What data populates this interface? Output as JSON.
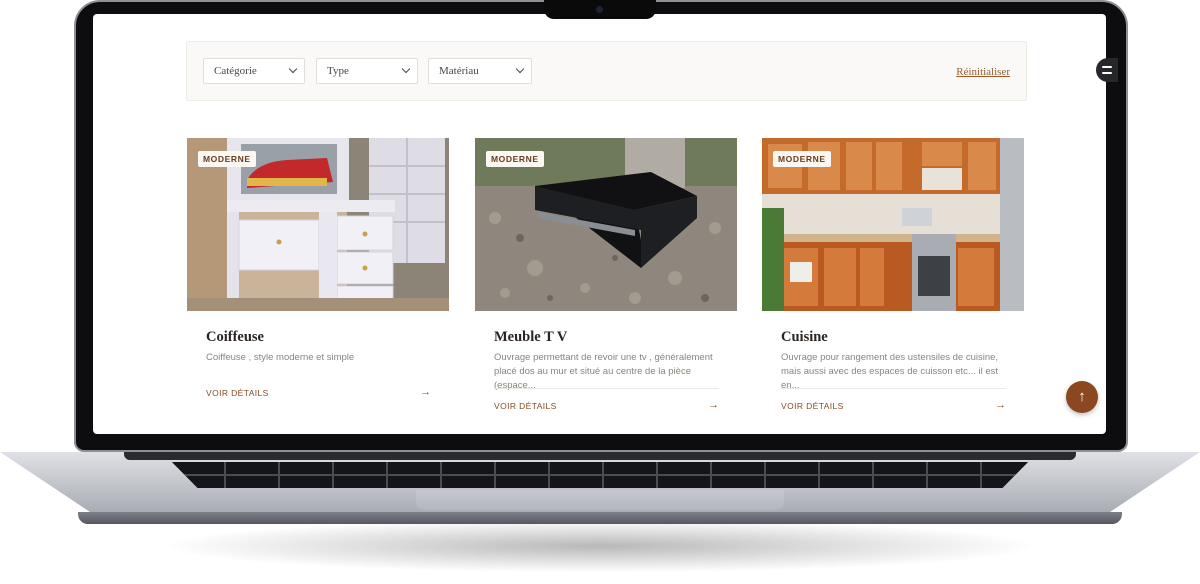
{
  "filters": {
    "category": {
      "label": "Catégorie"
    },
    "type": {
      "label": "Type"
    },
    "material": {
      "label": "Matériau"
    },
    "reset_label": "Réinitialiser"
  },
  "products": [
    {
      "badge": "MODERNE",
      "title": "Coiffeuse",
      "description": "Coiffeuse , style moderne et simple",
      "link": "VOIR DÉTAILS",
      "image": "dressing-table-photo"
    },
    {
      "badge": "MODERNE",
      "title": "Meuble T V",
      "description": "Ouvrage permettant de revoir une tv , généralement placé dos au mur et situé au centre de la pièce (espace...",
      "link": "VOIR DÉTAILS",
      "image": "tv-stand-photo"
    },
    {
      "badge": "MODERNE",
      "title": "Cuisine",
      "description": "Ouvrage pour rangement des ustensiles de cuisine, mais aussi avec des espaces de cuisson etc... il est en...",
      "link": "VOIR DÉTAILS",
      "image": "kitchen-photo"
    }
  ],
  "icons": {
    "filter_toggle": "sliders-icon",
    "scroll_top": "arrow-up-icon",
    "card_arrow": "arrow-right-icon"
  },
  "colors": {
    "accent": "#8b4a22",
    "badge_text": "#6a3b1c",
    "scroll_top_bg": "#8a4720"
  }
}
